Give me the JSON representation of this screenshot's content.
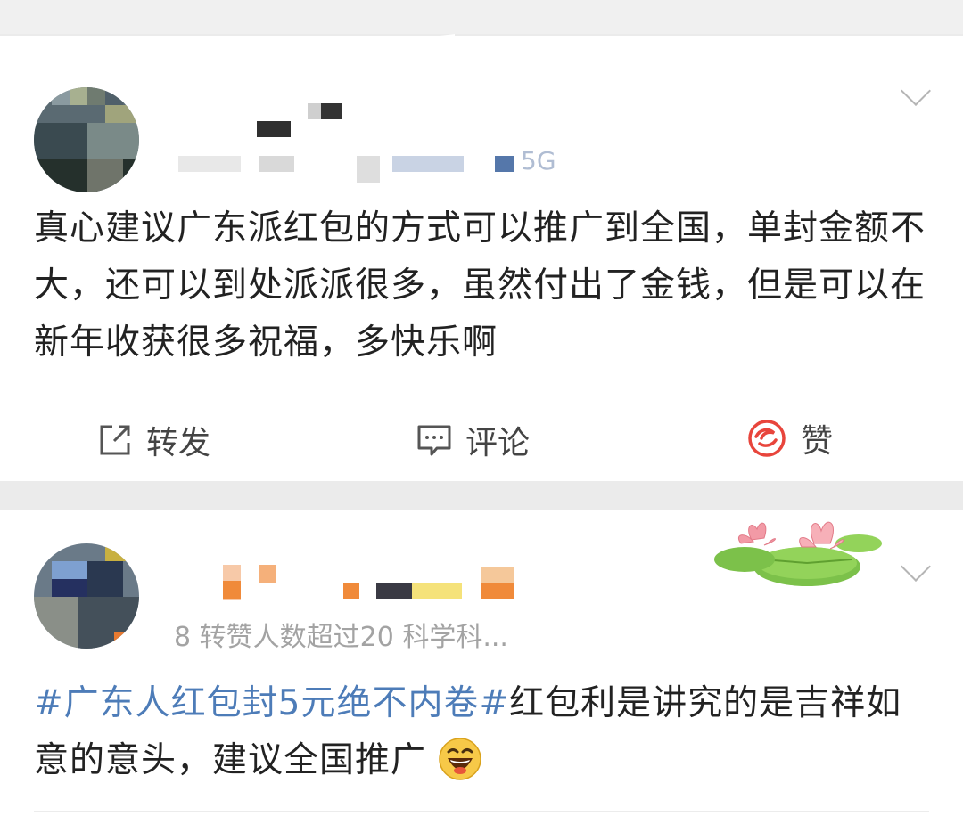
{
  "post1": {
    "text": "真心建议广东派红包的方式可以推广到全国，单封金额不大，还可以到处派派很多，虽然付出了金钱，但是可以在新年收获很多祝福，多快乐啊",
    "meta_fragment": "5G",
    "actions": {
      "repost_label": "转发",
      "comment_label": "评论",
      "like_label": "赞"
    }
  },
  "post2": {
    "meta_text": "8 转赞人数超过20  科学科...",
    "hashtag": "#广东人红包封5元绝不内卷#",
    "text": "红包利是讲究的是吉祥如意的意头，建议全国推广",
    "emoji": "laughing-emoji"
  },
  "colors": {
    "hashtag": "#4d7cb8",
    "like_icon": "#e8453c",
    "page_bg": "#ebebeb"
  }
}
